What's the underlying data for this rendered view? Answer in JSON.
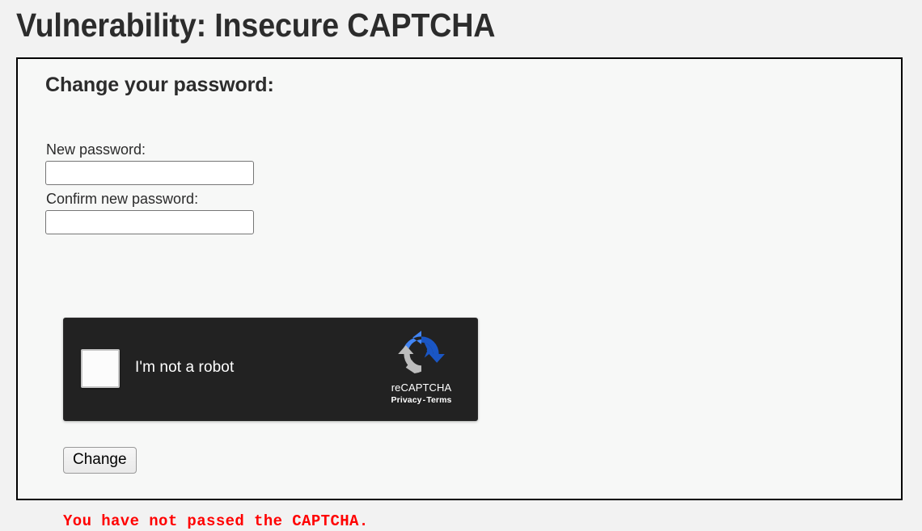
{
  "page": {
    "title": "Vulnerability: Insecure CAPTCHA"
  },
  "panel": {
    "heading": "Change your password:"
  },
  "form": {
    "new_password": {
      "label": "New password:",
      "value": "",
      "placeholder": ""
    },
    "confirm_password": {
      "label": "Confirm new password:",
      "value": "",
      "placeholder": ""
    },
    "submit_label": "Change"
  },
  "recaptcha": {
    "checkbox_checked": false,
    "label": "I'm not a robot",
    "brand_name": "reCAPTCHA",
    "privacy_label": "Privacy",
    "separator": "-",
    "terms_label": "Terms",
    "theme": "dark",
    "colors": {
      "background": "#222222",
      "logo_light_blue": "#4285F4",
      "logo_dark_blue": "#1A56C4",
      "logo_gray": "#BDBDBD",
      "text": "#FFFFFF"
    }
  },
  "status": {
    "error_message": "You have not passed the CAPTCHA.",
    "error_color": "#FF0000"
  },
  "theme": {
    "page_background": "#F2F2F2",
    "panel_background": "#F7F8F7",
    "panel_border": "#000000",
    "text_color": "#2C2C2C"
  }
}
